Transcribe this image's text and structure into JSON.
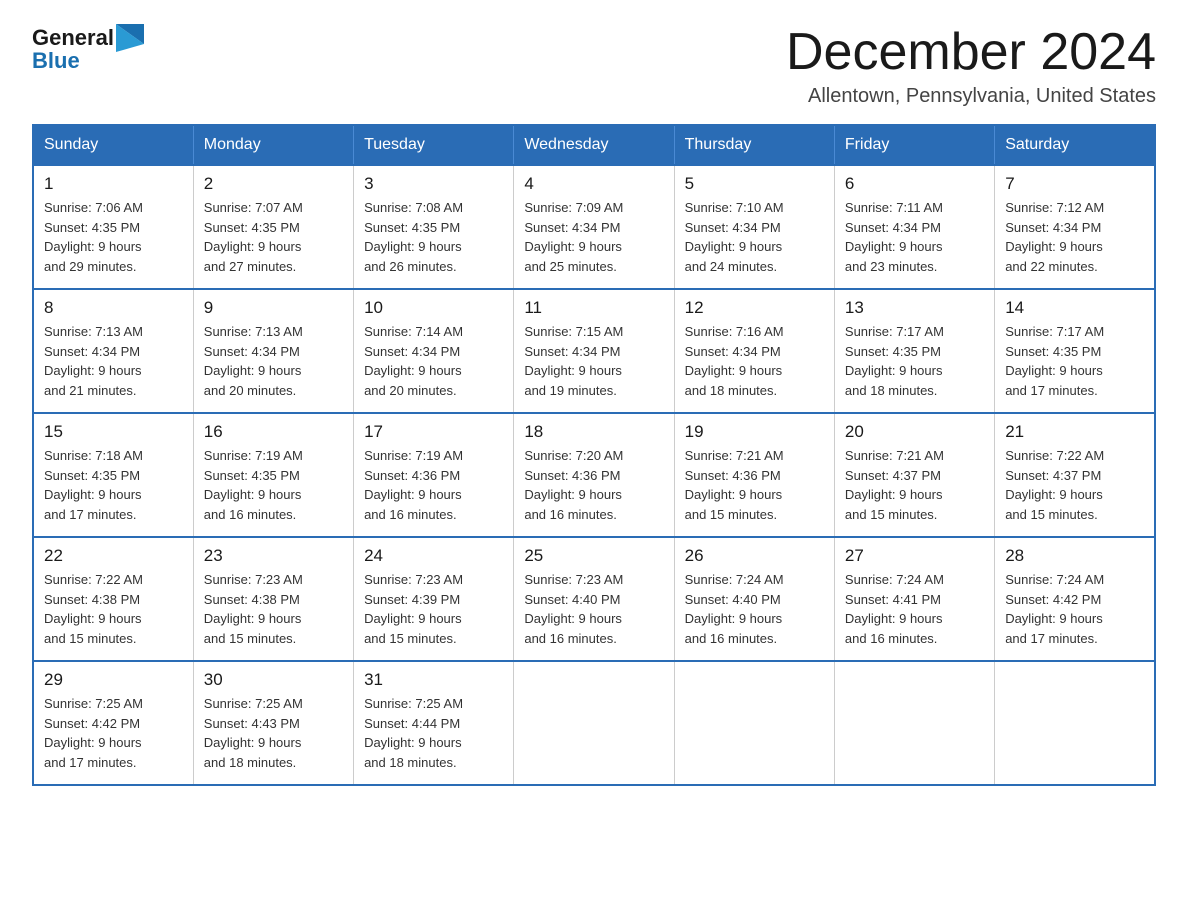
{
  "logo": {
    "text_general": "General",
    "text_blue": "Blue"
  },
  "title": {
    "month_year": "December 2024",
    "location": "Allentown, Pennsylvania, United States"
  },
  "days_of_week": [
    "Sunday",
    "Monday",
    "Tuesday",
    "Wednesday",
    "Thursday",
    "Friday",
    "Saturday"
  ],
  "weeks": [
    [
      {
        "day": "1",
        "sunrise": "7:06 AM",
        "sunset": "4:35 PM",
        "daylight": "9 hours and 29 minutes."
      },
      {
        "day": "2",
        "sunrise": "7:07 AM",
        "sunset": "4:35 PM",
        "daylight": "9 hours and 27 minutes."
      },
      {
        "day": "3",
        "sunrise": "7:08 AM",
        "sunset": "4:35 PM",
        "daylight": "9 hours and 26 minutes."
      },
      {
        "day": "4",
        "sunrise": "7:09 AM",
        "sunset": "4:34 PM",
        "daylight": "9 hours and 25 minutes."
      },
      {
        "day": "5",
        "sunrise": "7:10 AM",
        "sunset": "4:34 PM",
        "daylight": "9 hours and 24 minutes."
      },
      {
        "day": "6",
        "sunrise": "7:11 AM",
        "sunset": "4:34 PM",
        "daylight": "9 hours and 23 minutes."
      },
      {
        "day": "7",
        "sunrise": "7:12 AM",
        "sunset": "4:34 PM",
        "daylight": "9 hours and 22 minutes."
      }
    ],
    [
      {
        "day": "8",
        "sunrise": "7:13 AM",
        "sunset": "4:34 PM",
        "daylight": "9 hours and 21 minutes."
      },
      {
        "day": "9",
        "sunrise": "7:13 AM",
        "sunset": "4:34 PM",
        "daylight": "9 hours and 20 minutes."
      },
      {
        "day": "10",
        "sunrise": "7:14 AM",
        "sunset": "4:34 PM",
        "daylight": "9 hours and 20 minutes."
      },
      {
        "day": "11",
        "sunrise": "7:15 AM",
        "sunset": "4:34 PM",
        "daylight": "9 hours and 19 minutes."
      },
      {
        "day": "12",
        "sunrise": "7:16 AM",
        "sunset": "4:34 PM",
        "daylight": "9 hours and 18 minutes."
      },
      {
        "day": "13",
        "sunrise": "7:17 AM",
        "sunset": "4:35 PM",
        "daylight": "9 hours and 18 minutes."
      },
      {
        "day": "14",
        "sunrise": "7:17 AM",
        "sunset": "4:35 PM",
        "daylight": "9 hours and 17 minutes."
      }
    ],
    [
      {
        "day": "15",
        "sunrise": "7:18 AM",
        "sunset": "4:35 PM",
        "daylight": "9 hours and 17 minutes."
      },
      {
        "day": "16",
        "sunrise": "7:19 AM",
        "sunset": "4:35 PM",
        "daylight": "9 hours and 16 minutes."
      },
      {
        "day": "17",
        "sunrise": "7:19 AM",
        "sunset": "4:36 PM",
        "daylight": "9 hours and 16 minutes."
      },
      {
        "day": "18",
        "sunrise": "7:20 AM",
        "sunset": "4:36 PM",
        "daylight": "9 hours and 16 minutes."
      },
      {
        "day": "19",
        "sunrise": "7:21 AM",
        "sunset": "4:36 PM",
        "daylight": "9 hours and 15 minutes."
      },
      {
        "day": "20",
        "sunrise": "7:21 AM",
        "sunset": "4:37 PM",
        "daylight": "9 hours and 15 minutes."
      },
      {
        "day": "21",
        "sunrise": "7:22 AM",
        "sunset": "4:37 PM",
        "daylight": "9 hours and 15 minutes."
      }
    ],
    [
      {
        "day": "22",
        "sunrise": "7:22 AM",
        "sunset": "4:38 PM",
        "daylight": "9 hours and 15 minutes."
      },
      {
        "day": "23",
        "sunrise": "7:23 AM",
        "sunset": "4:38 PM",
        "daylight": "9 hours and 15 minutes."
      },
      {
        "day": "24",
        "sunrise": "7:23 AM",
        "sunset": "4:39 PM",
        "daylight": "9 hours and 15 minutes."
      },
      {
        "day": "25",
        "sunrise": "7:23 AM",
        "sunset": "4:40 PM",
        "daylight": "9 hours and 16 minutes."
      },
      {
        "day": "26",
        "sunrise": "7:24 AM",
        "sunset": "4:40 PM",
        "daylight": "9 hours and 16 minutes."
      },
      {
        "day": "27",
        "sunrise": "7:24 AM",
        "sunset": "4:41 PM",
        "daylight": "9 hours and 16 minutes."
      },
      {
        "day": "28",
        "sunrise": "7:24 AM",
        "sunset": "4:42 PM",
        "daylight": "9 hours and 17 minutes."
      }
    ],
    [
      {
        "day": "29",
        "sunrise": "7:25 AM",
        "sunset": "4:42 PM",
        "daylight": "9 hours and 17 minutes."
      },
      {
        "day": "30",
        "sunrise": "7:25 AM",
        "sunset": "4:43 PM",
        "daylight": "9 hours and 18 minutes."
      },
      {
        "day": "31",
        "sunrise": "7:25 AM",
        "sunset": "4:44 PM",
        "daylight": "9 hours and 18 minutes."
      },
      null,
      null,
      null,
      null
    ]
  ],
  "labels": {
    "sunrise": "Sunrise:",
    "sunset": "Sunset:",
    "daylight": "Daylight:"
  }
}
